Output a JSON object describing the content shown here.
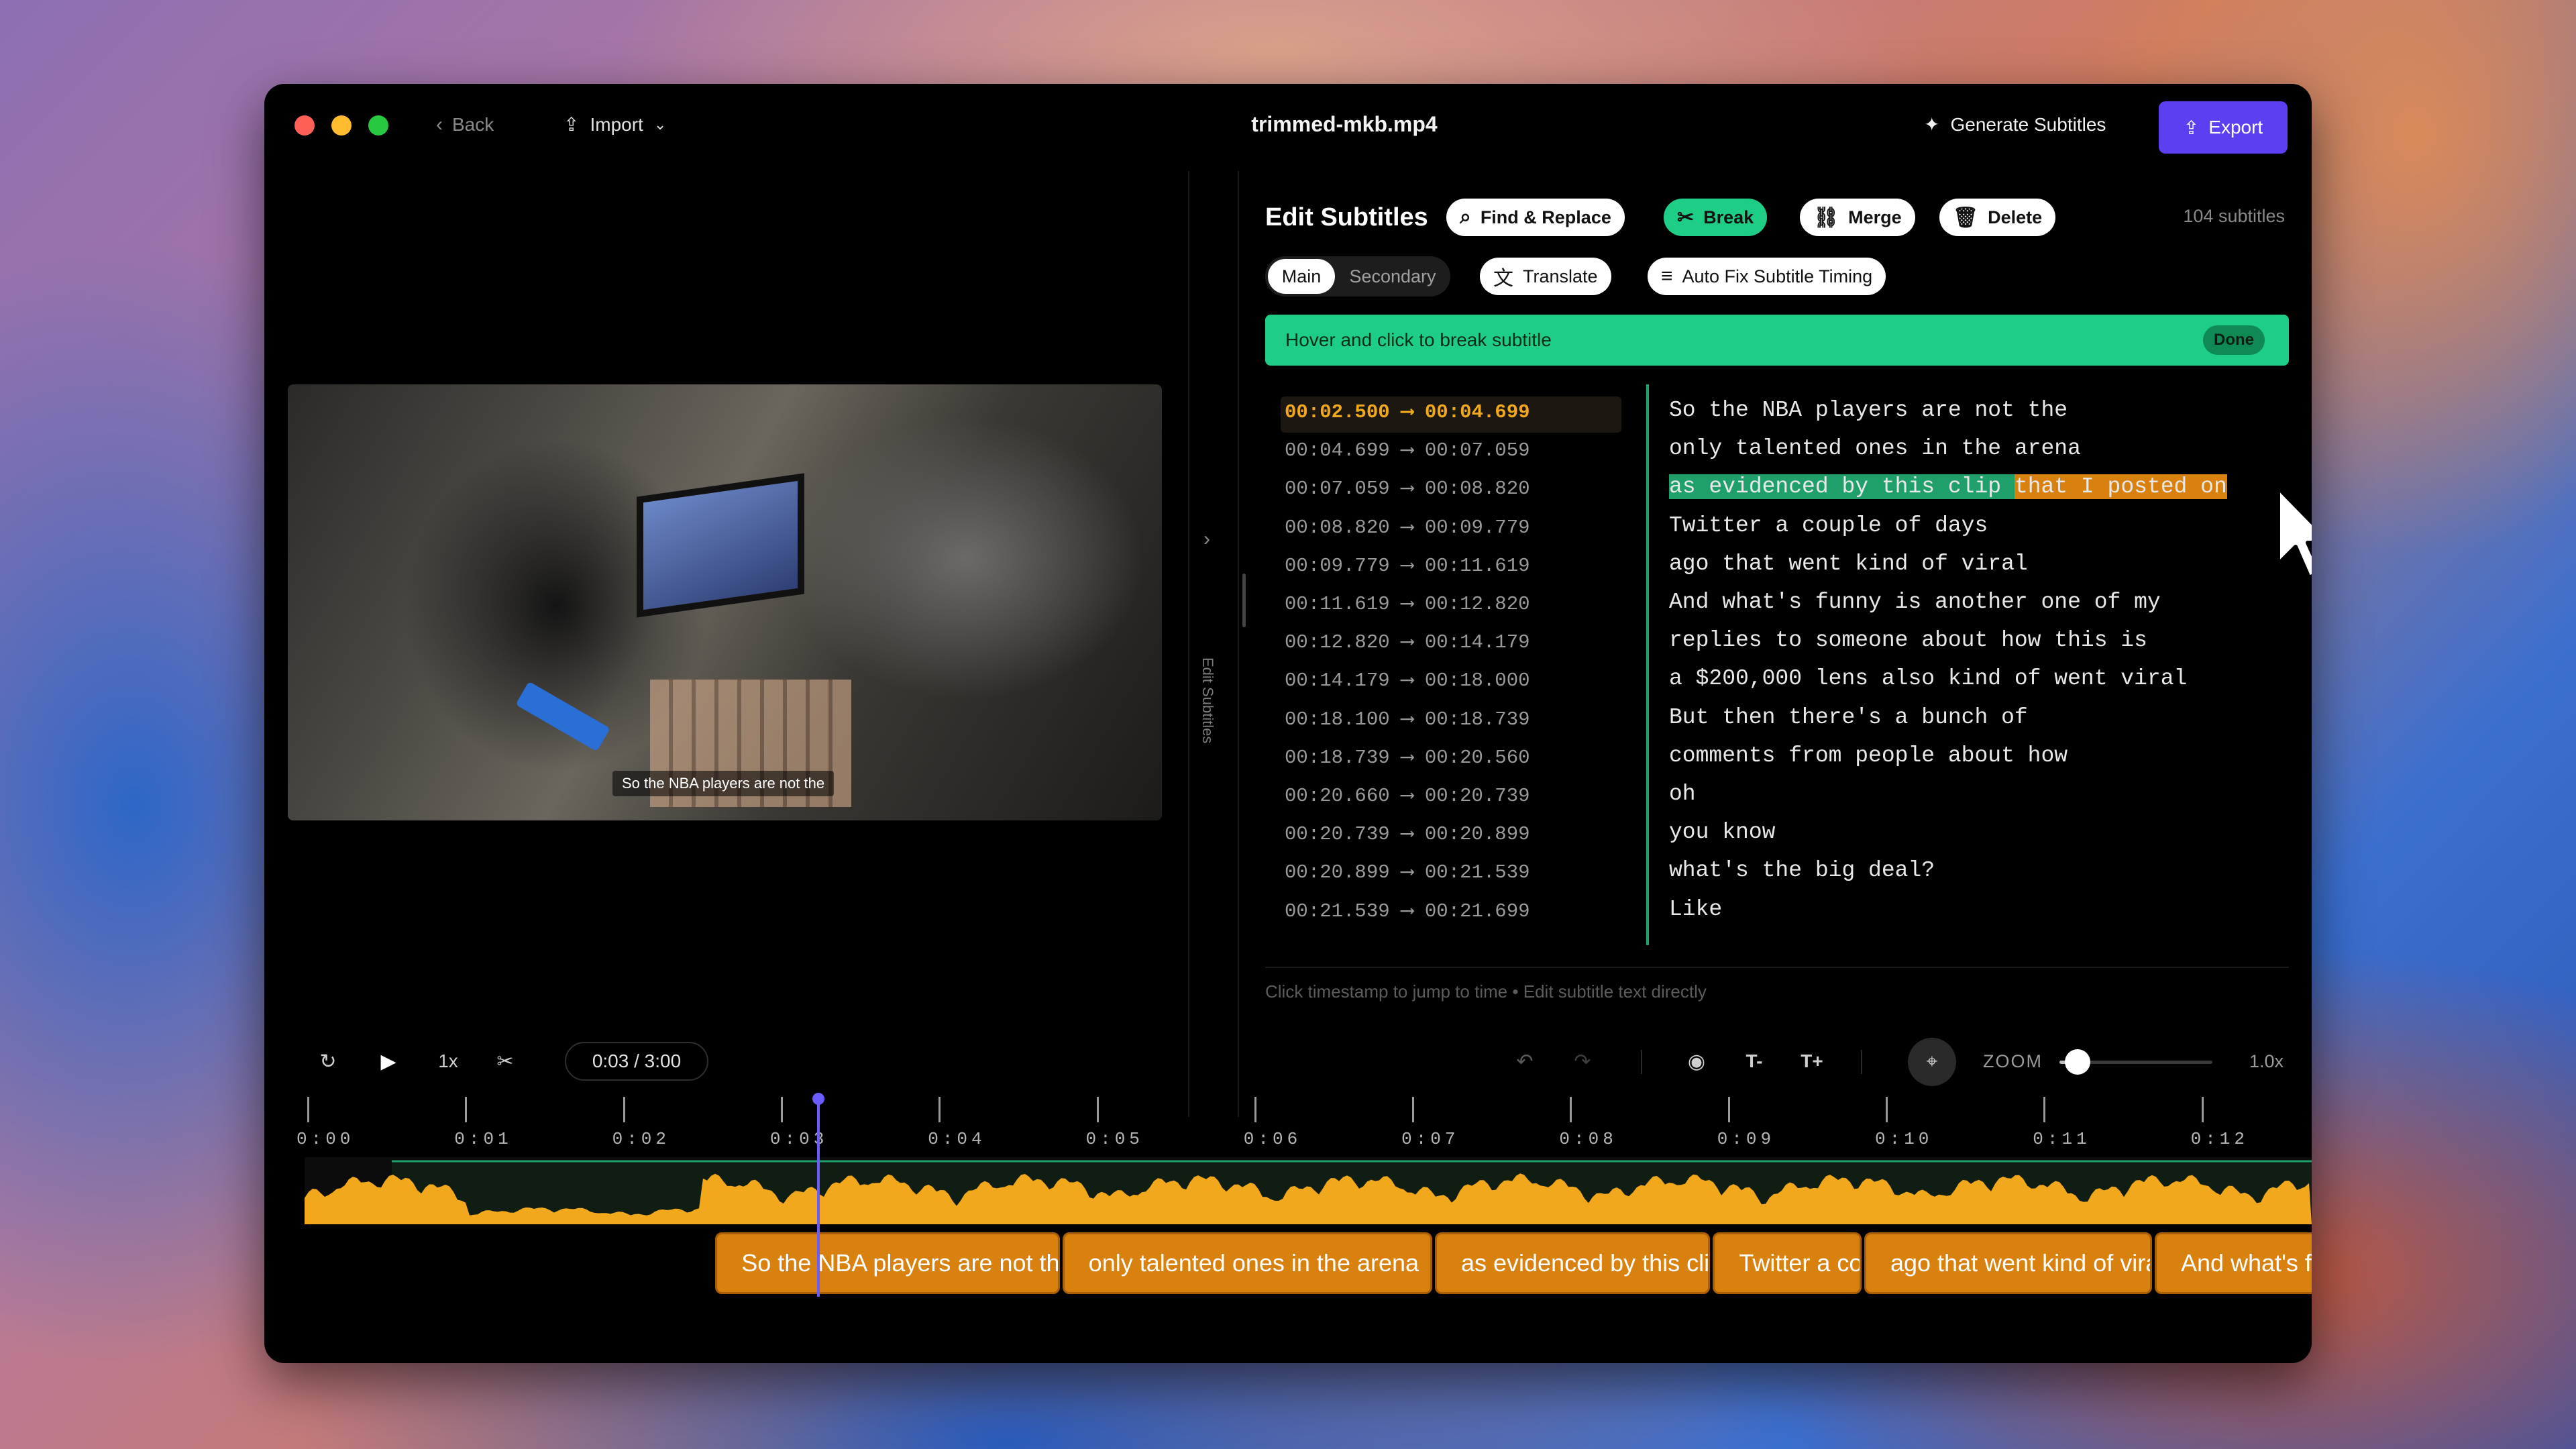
{
  "titlebar": {
    "back": "Back",
    "import": "Import",
    "filename": "trimmed-mkb.mp4",
    "generate": "Generate Subtitles",
    "export": "Export"
  },
  "video": {
    "caption": "So the NBA players are not the",
    "sidebar_label": "Edit Subtitles"
  },
  "editor": {
    "title": "Edit Subtitles",
    "find_replace": "Find & Replace",
    "break": "Break",
    "merge": "Merge",
    "delete": "Delete",
    "count": "104 subtitles",
    "main": "Main",
    "secondary": "Secondary",
    "translate": "Translate",
    "autofix": "Auto Fix Subtitle Timing",
    "banner": "Hover and click to break subtitle",
    "done": "Done",
    "footer": "Click timestamp to jump to time • Edit subtitle text directly"
  },
  "subtitles": [
    {
      "time": "00:02.500 ⟶ 00:04.699",
      "text": "So the NBA players are not the"
    },
    {
      "time": "00:04.699 ⟶ 00:07.059",
      "text": "only talented ones in the arena"
    },
    {
      "time": "00:07.059 ⟶ 00:08.820",
      "text_a": "as evidenced by this clip ",
      "text_b": "that I posted on"
    },
    {
      "time": "00:08.820 ⟶ 00:09.779",
      "text": "Twitter a couple of days"
    },
    {
      "time": "00:09.779 ⟶ 00:11.619",
      "text": "ago that went kind of viral"
    },
    {
      "time": "00:11.619 ⟶ 00:12.820",
      "text": "And what's funny is another one of my"
    },
    {
      "time": "00:12.820 ⟶ 00:14.179",
      "text": "replies to someone about how this is"
    },
    {
      "time": "00:14.179 ⟶ 00:18.000",
      "text": "a $200,000 lens also kind of went viral"
    },
    {
      "time": "00:18.100 ⟶ 00:18.739",
      "text": "But then there's a bunch of"
    },
    {
      "time": "00:18.739 ⟶ 00:20.560",
      "text": "comments from people about how"
    },
    {
      "time": "00:20.660 ⟶ 00:20.739",
      "text": "oh"
    },
    {
      "time": "00:20.739 ⟶ 00:20.899",
      "text": "you know"
    },
    {
      "time": "00:20.899 ⟶ 00:21.539",
      "text": "what's the big deal?"
    },
    {
      "time": "00:21.539 ⟶ 00:21.699",
      "text": "Like"
    }
  ],
  "controls": {
    "speed": "1x",
    "time": "0:03 / 3:00",
    "zoom_label": "ZOOM",
    "zoom_value": "1.0x",
    "zoom_level": 0.12,
    "text_smaller": "T-",
    "text_bigger": "T+"
  },
  "timeline": {
    "labels": [
      "0:00",
      "0:01",
      "0:02",
      "0:03",
      "0:04",
      "0:05",
      "0:06",
      "0:07",
      "0:08",
      "0:09",
      "0:10",
      "0:11",
      "0:12"
    ],
    "playhead_seconds": 3.23,
    "chips": [
      "So the NBA players are not the",
      "only talented ones in the arena",
      "as evidenced by this clip",
      "Twitter a couple of days",
      "ago that went kind of viral",
      "And what's funny"
    ]
  },
  "colors": {
    "accent": "#5b3ff0",
    "green": "#1fce86",
    "orange": "#d9810f",
    "waveform": "#f2a81d"
  }
}
